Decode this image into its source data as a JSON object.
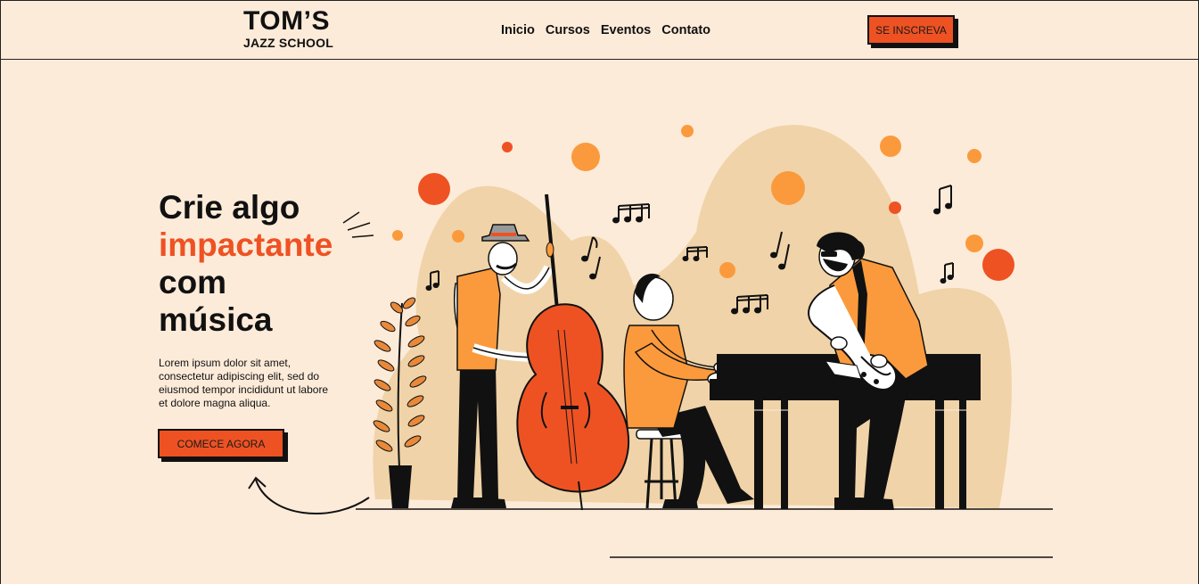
{
  "header": {
    "logo_main": "TOM’S",
    "logo_sub": "JAZZ SCHOOL",
    "nav": [
      "Inicio",
      "Cursos",
      "Eventos",
      "Contato"
    ],
    "signup_label": "SE INSCREVA"
  },
  "hero": {
    "title_line1": "Crie algo",
    "title_accent": "impactante",
    "title_line3": "com",
    "title_line4": "música",
    "description": "Lorem ipsum dolor sit amet, consectetur adipiscing elit, sed do eiusmod tempor incididunt ut labore et dolore magna aliqua.",
    "cta_label": "COMECE AGORA"
  },
  "colors": {
    "background": "#fdebd9",
    "accent": "#ee5223",
    "orange_light": "#fb9a3c",
    "blob": "#f0d3a8",
    "ink": "#111111"
  },
  "icons": [
    "music-note-icon",
    "arrow-icon"
  ]
}
